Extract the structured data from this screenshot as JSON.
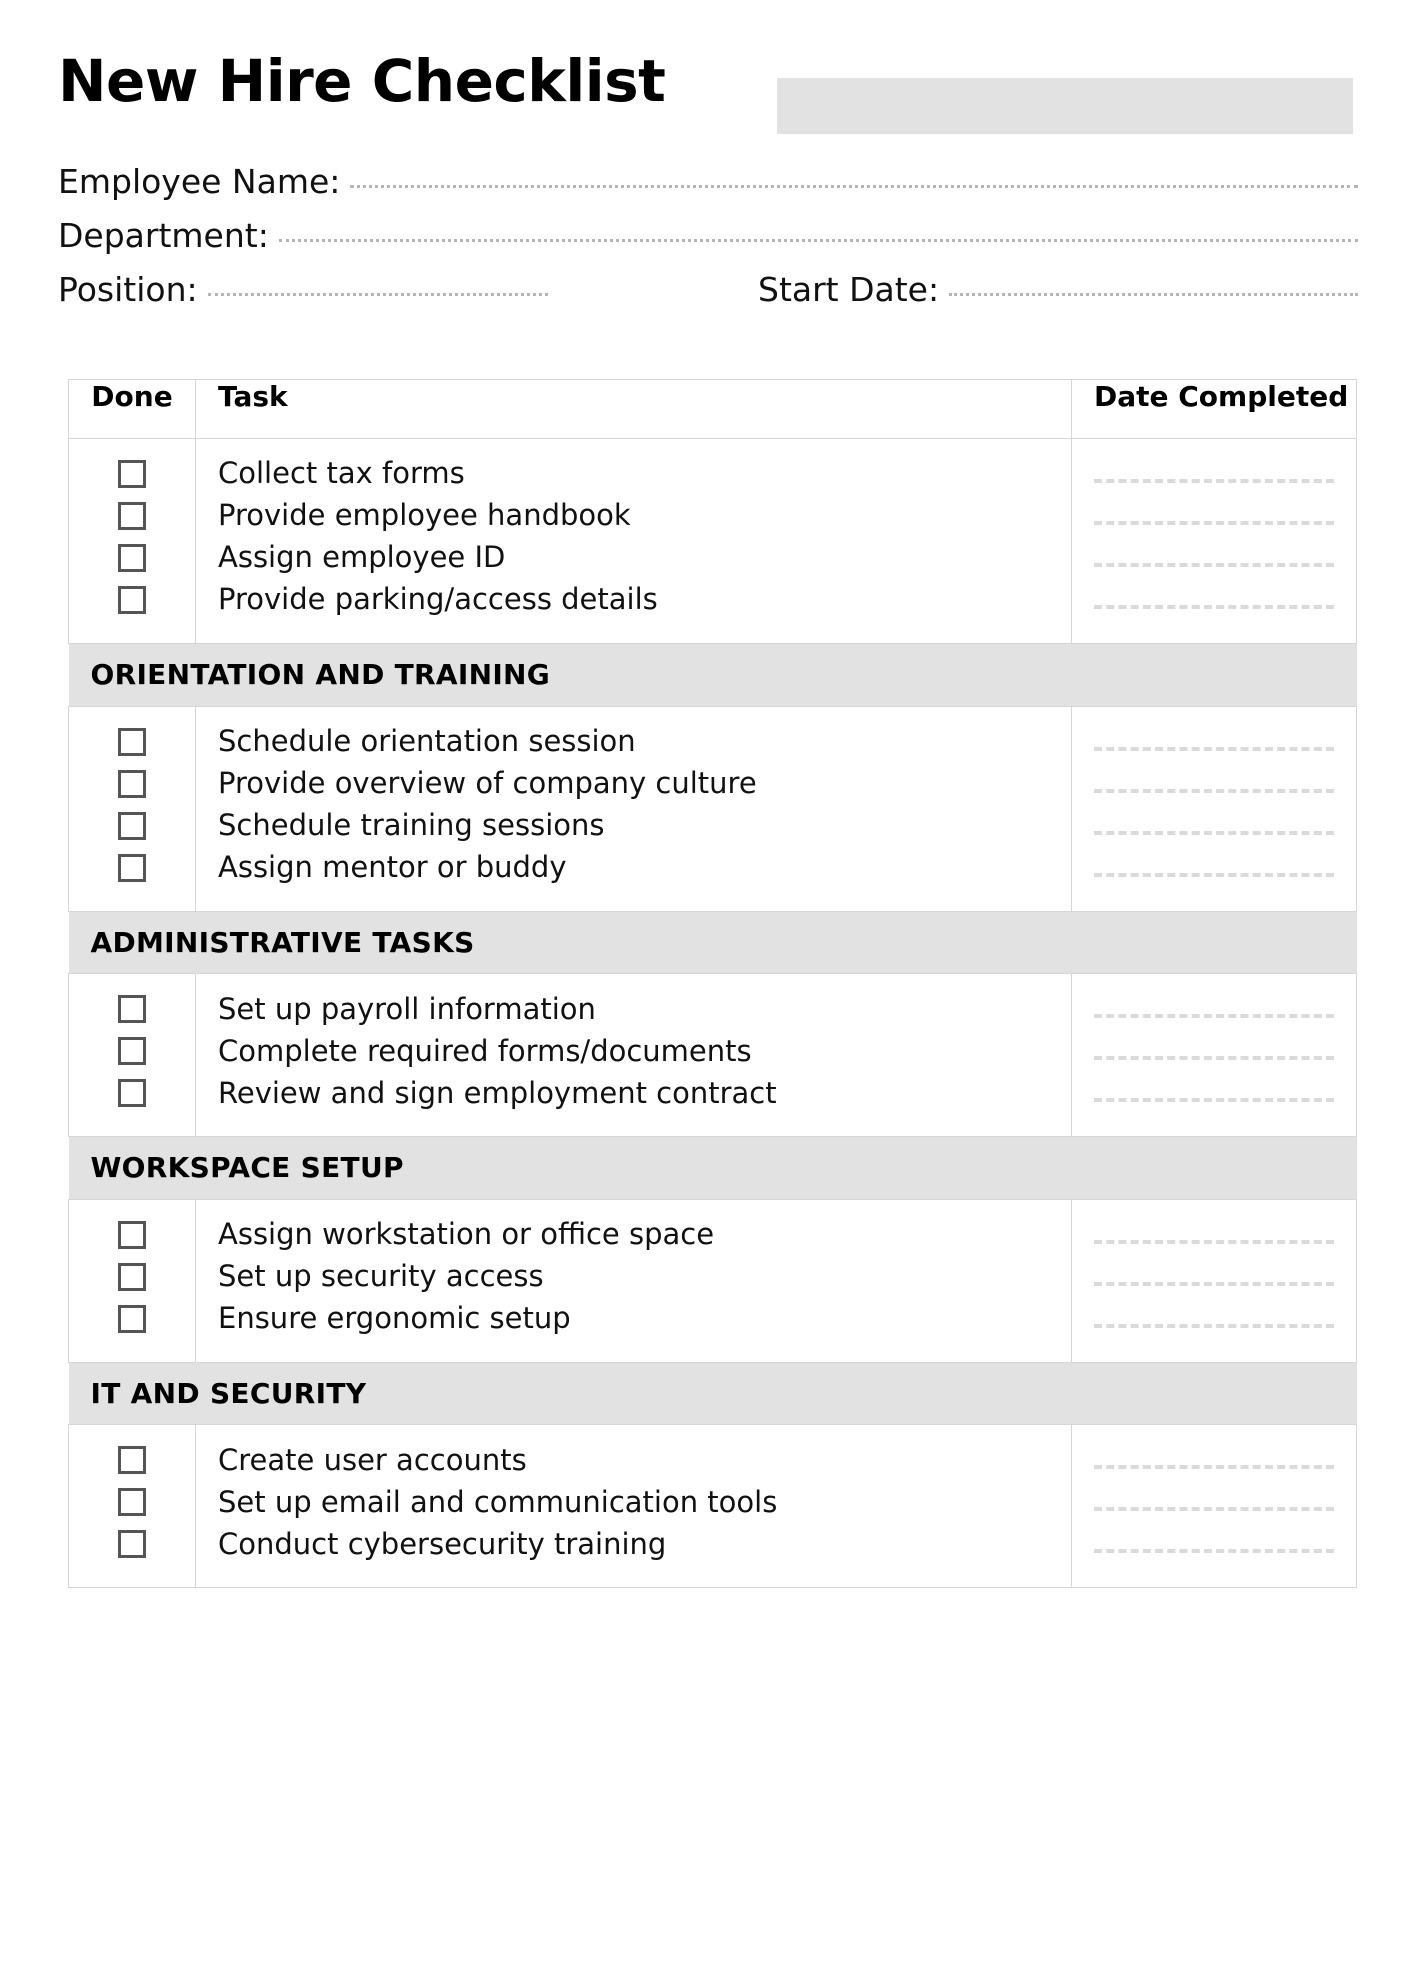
{
  "document": {
    "title": "New Hire Checklist",
    "accent_block_color": "#e2e2e2"
  },
  "meta_fields": [
    {
      "label": "Employee Name:",
      "value": ""
    },
    {
      "label": "Department:",
      "value": ""
    },
    {
      "label": "Position:",
      "value": ""
    },
    {
      "label": "Start Date:",
      "value": ""
    }
  ],
  "table": {
    "columns": {
      "done": "Done",
      "task": "Task",
      "date": "Date Completed"
    },
    "groups": [
      {
        "section": "",
        "show_section": false,
        "tasks": [
          "Collect tax forms",
          "Provide employee handbook",
          "Assign employee ID",
          "Provide parking/access details"
        ]
      },
      {
        "section": "ORIENTATION AND TRAINING",
        "show_section": true,
        "tasks": [
          "Schedule orientation session",
          "Provide overview of company culture",
          "Schedule training sessions",
          "Assign mentor or buddy"
        ]
      },
      {
        "section": "ADMINISTRATIVE TASKS",
        "show_section": true,
        "tasks": [
          "Set up payroll information",
          "Complete required forms/documents",
          "Review and sign employment contract"
        ]
      },
      {
        "section": "WORKSPACE SETUP",
        "show_section": true,
        "tasks": [
          "Assign workstation or office space",
          "Set up security access",
          "Ensure ergonomic setup"
        ]
      },
      {
        "section": "IT AND SECURITY",
        "show_section": true,
        "tasks": [
          "Create user accounts",
          "Set up email and communication tools",
          "Conduct cybersecurity training"
        ]
      }
    ]
  }
}
